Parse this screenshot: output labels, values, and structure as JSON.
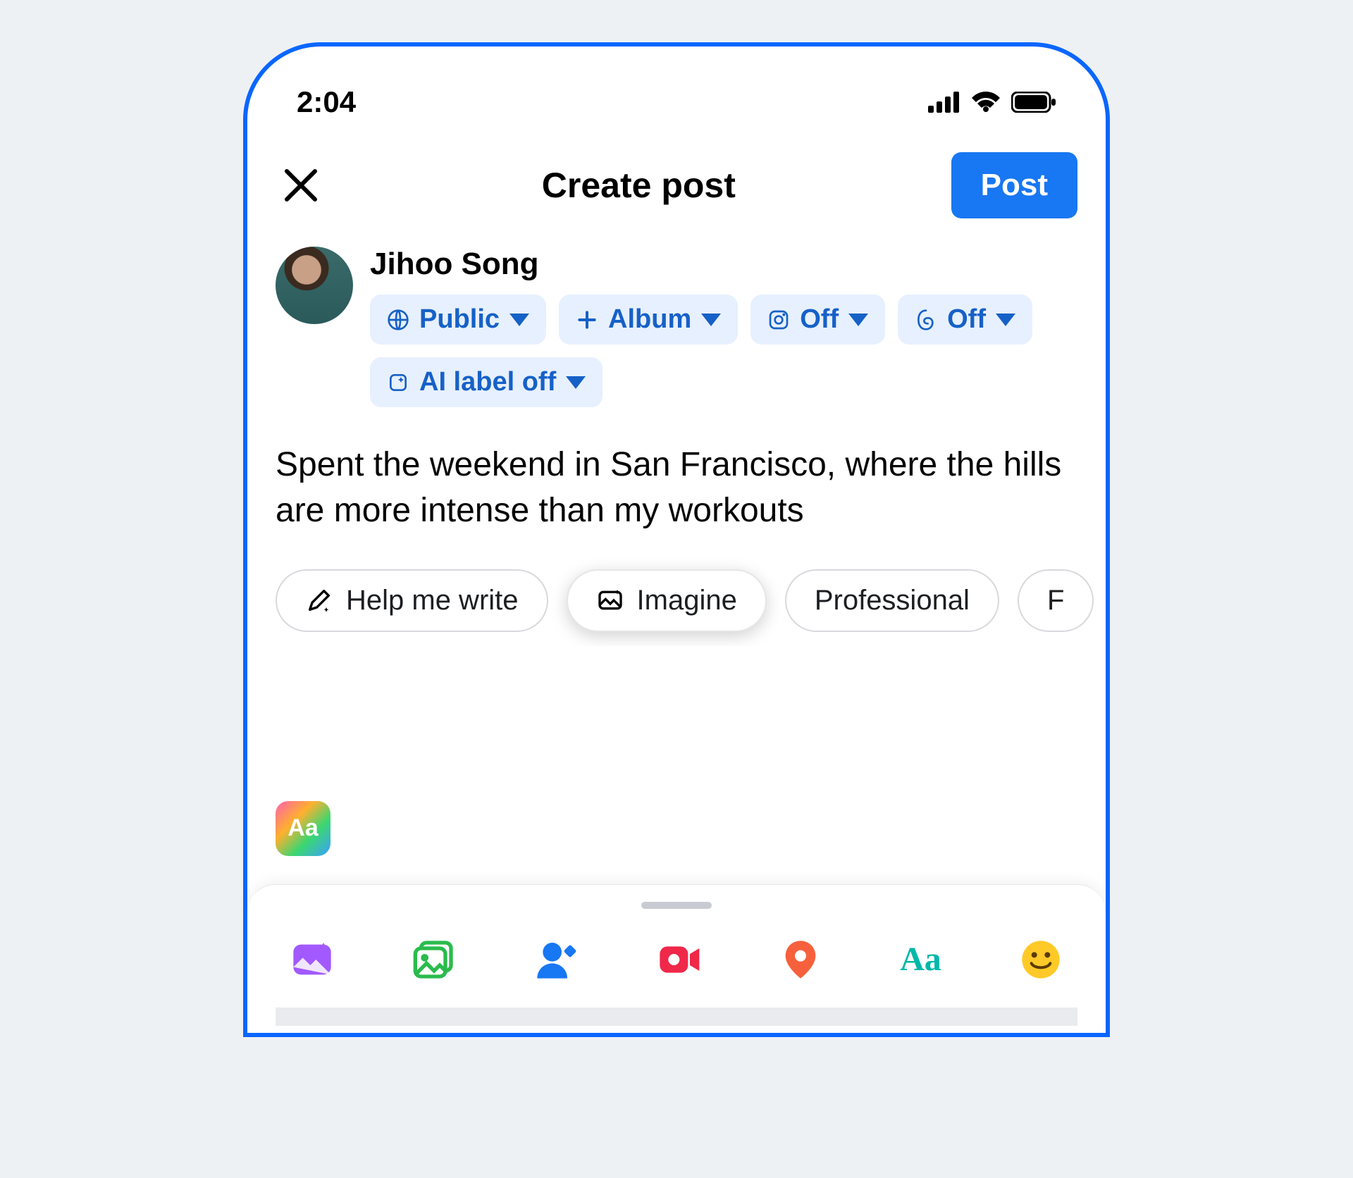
{
  "status_bar": {
    "time": "2:04"
  },
  "header": {
    "title": "Create post",
    "post_button": "Post"
  },
  "user": {
    "name": "Jihoo Song",
    "chips": {
      "audience": "Public",
      "album": "Album",
      "instagram": "Off",
      "threads": "Off",
      "ai_label": "AI label off"
    }
  },
  "post_text": "Spent the weekend in San Francisco, where the hills are more intense than my workouts",
  "suggestions": {
    "help_write": "Help me write",
    "imagine": "Imagine",
    "professional": "Professional",
    "next_partial": "F"
  },
  "bg_button_label": "Aa",
  "text_tool_label": "Aa"
}
